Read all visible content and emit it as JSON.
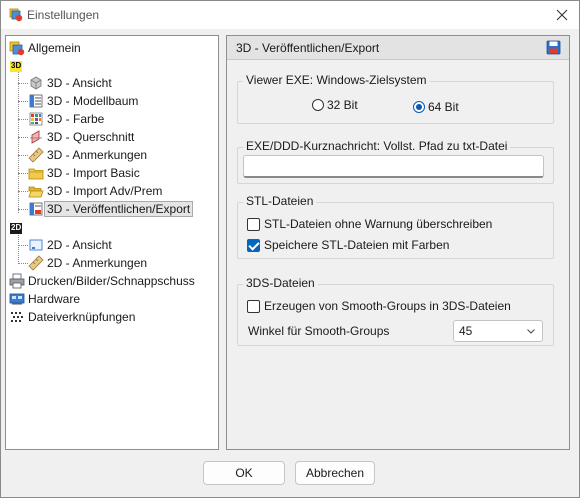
{
  "window": {
    "title": "Einstellungen",
    "close_icon": "close-icon"
  },
  "tree": {
    "root_general": "Allgemein",
    "badge_3d": "3D",
    "badge_2d": "2D",
    "items_3d": [
      "3D - Ansicht",
      "3D - Modellbaum",
      "3D - Farbe",
      "3D - Querschnitt",
      "3D - Anmerkungen",
      "3D - Import Basic",
      "3D - Import Adv/Prem",
      "3D - Veröffentlichen/Export"
    ],
    "items_2d": [
      "2D - Ansicht",
      "2D - Anmerkungen"
    ],
    "print": "Drucken/Bilder/Schnappschuss",
    "hardware": "Hardware",
    "file_assoc": "Dateiverknüpfungen",
    "selected": "3D - Veröffentlichen/Export"
  },
  "panel": {
    "title": "3D - Veröffentlichen/Export",
    "viewer": {
      "label": "Viewer EXE: Windows-Zielsystem",
      "option_32": "32 Bit",
      "option_64": "64 Bit",
      "selected": "64 Bit"
    },
    "message": {
      "label": "EXE/DDD-Kurznachricht: Vollst. Pfad zu txt-Datei",
      "value": ""
    },
    "stl": {
      "label": "STL-Dateien",
      "overwrite_label": "STL-Dateien ohne Warnung überschreiben",
      "overwrite_checked": false,
      "colors_label": "Speichere STL-Dateien mit Farben",
      "colors_checked": true
    },
    "tds": {
      "label": "3DS-Dateien",
      "smooth_label": "Erzeugen von Smooth-Groups in 3DS-Dateien",
      "smooth_checked": false,
      "angle_label": "Winkel für Smooth-Groups",
      "angle_value": "45"
    }
  },
  "buttons": {
    "ok": "OK",
    "cancel": "Abbrechen"
  }
}
